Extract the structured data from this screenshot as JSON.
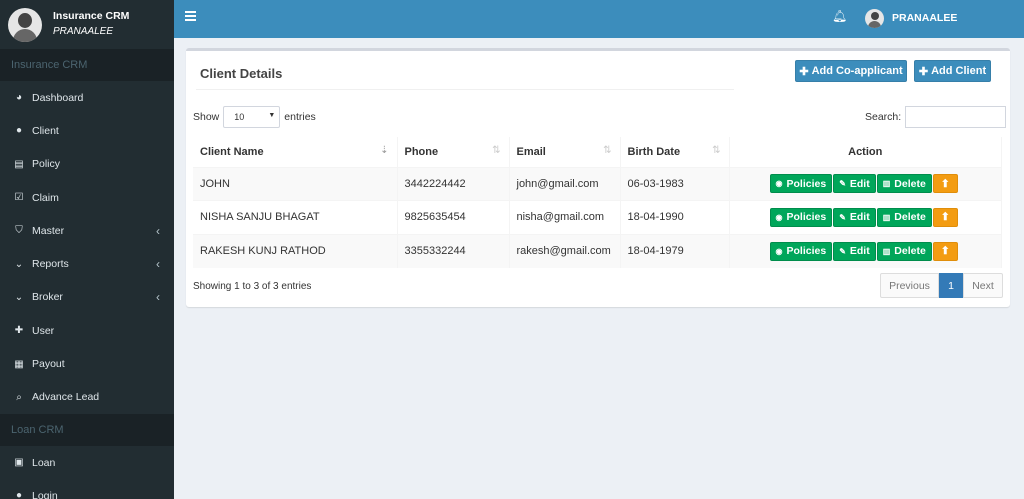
{
  "sidebar": {
    "brand_title": "Insurance CRM",
    "brand_user": "PRANAALEE",
    "section1": "Insurance CRM",
    "items": [
      {
        "label": "Dashboard",
        "icon": "dashboard-icon",
        "glyph": "◕",
        "chevron": false
      },
      {
        "label": "Client",
        "icon": "user-icon",
        "glyph": "●",
        "chevron": false
      },
      {
        "label": "Policy",
        "icon": "file-icon",
        "glyph": "▤",
        "chevron": false
      },
      {
        "label": "Claim",
        "icon": "calendar-check-icon",
        "glyph": "☑",
        "chevron": false
      },
      {
        "label": "Master",
        "icon": "shield-icon",
        "glyph": "⛉",
        "chevron": true
      },
      {
        "label": "Reports",
        "icon": "chevron-down-icon",
        "glyph": "⌄",
        "chevron": true
      },
      {
        "label": "Broker",
        "icon": "chevron-down-icon",
        "glyph": "⌄",
        "chevron": true
      },
      {
        "label": "User",
        "icon": "user-plus-icon",
        "glyph": "✚",
        "chevron": false
      },
      {
        "label": "Payout",
        "icon": "calculator-icon",
        "glyph": "▦",
        "chevron": false
      },
      {
        "label": "Advance Lead",
        "icon": "search-icon",
        "glyph": "⌕",
        "chevron": false
      }
    ],
    "section2": "Loan CRM",
    "items2": [
      {
        "label": "Loan",
        "icon": "money-icon",
        "glyph": "▣"
      },
      {
        "label": "Login",
        "icon": "user-icon",
        "glyph": "●"
      }
    ]
  },
  "topbar": {
    "user": "PRANAALEE"
  },
  "main": {
    "title": "Client Details",
    "add_coapplicant": "Add Co-applicant",
    "add_client": "Add Client",
    "show_label": "Show",
    "entries_label": "entries",
    "page_size": "10",
    "search_label": "Search:",
    "columns": [
      "Client Name",
      "Phone",
      "Email",
      "Birth Date",
      "Action"
    ],
    "rows": [
      {
        "name": "JOHN",
        "phone": "3442224442",
        "email": "john@gmail.com",
        "birth": "06-03-1983"
      },
      {
        "name": "NISHA SANJU BHAGAT",
        "phone": "9825635454",
        "email": "nisha@gmail.com",
        "birth": "18-04-1990"
      },
      {
        "name": "RAKESH KUNJ RATHOD",
        "phone": "3355332244",
        "email": "rakesh@gmail.com",
        "birth": "18-04-1979"
      }
    ],
    "action_labels": {
      "policies": "Policies",
      "edit": "Edit",
      "delete": "Delete"
    },
    "info": "Showing 1 to 3 of 3 entries",
    "pager": {
      "previous": "Previous",
      "current": "1",
      "next": "Next"
    }
  },
  "colors": {
    "sidebar_bg": "#222d32",
    "topbar_bg": "#3c8dbc",
    "success": "#00a65a",
    "warning": "#f39c12",
    "primary": "#337ab7"
  }
}
